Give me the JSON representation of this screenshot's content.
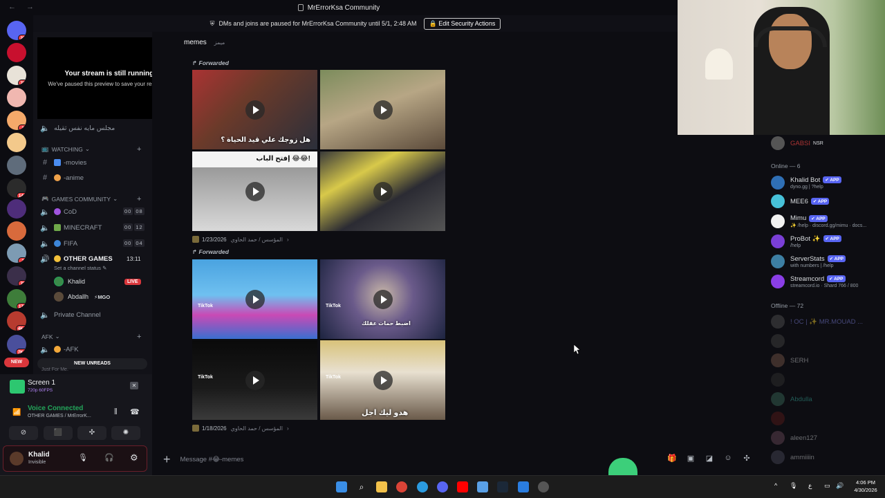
{
  "window": {
    "title": "MrErrorKsa Community"
  },
  "banner": {
    "message": "DMs and joins are paused for MrErrorKsa Community until 5/1, 2:48 AM",
    "button": "Edit Security Actions"
  },
  "servers": [
    {
      "icon": "discord-home-icon",
      "badge": "27",
      "color": "#5865f2"
    },
    {
      "icon": "nba-server-icon",
      "badge": "",
      "color": "#c8102e"
    },
    {
      "icon": "server-icon",
      "badge": "73",
      "color": "#e8e2d8"
    },
    {
      "icon": "server-icon",
      "badge": "",
      "color": "#f0b7b0"
    },
    {
      "icon": "server-icon",
      "badge": "1",
      "color": "#f4a96a"
    },
    {
      "icon": "server-icon",
      "badge": "",
      "color": "#f3c98b"
    },
    {
      "icon": "server-icon",
      "badge": "",
      "color": "#5f6c7b"
    },
    {
      "icon": "server-icon",
      "badge": "143",
      "color": "#2b2b2b"
    },
    {
      "icon": "server-icon",
      "badge": "",
      "color": "#4e2d7a"
    },
    {
      "icon": "server-icon",
      "badge": "",
      "color": "#d86a3c"
    },
    {
      "icon": "server-icon",
      "badge": "2",
      "color": "#7d9bb3"
    },
    {
      "icon": "server-icon",
      "badge": "73",
      "color": "#3b2f4a"
    },
    {
      "icon": "server-icon",
      "badge": "170",
      "color": "#3e7d3a"
    },
    {
      "icon": "server-icon",
      "badge": "4K+",
      "color": "#b73b2f"
    },
    {
      "icon": "server-icon",
      "badge": "7K+",
      "color": "#4a4f9c"
    },
    {
      "icon": "new-server-icon",
      "badge": "",
      "color": "#da373c"
    }
  ],
  "new_label": "NEW",
  "stream_preview": {
    "title": "Your stream is still running!",
    "subtitle": "We've paused this preview to save your resources."
  },
  "channels": {
    "top_voice": "مجلس مايه نفس ثقيله",
    "watching_category": "WATCHING",
    "watching": [
      "-movies",
      "-anime"
    ],
    "games_category": "GAMES COMMUNITY",
    "games": [
      {
        "name": "CoD",
        "counts": [
          "00",
          "08"
        ]
      },
      {
        "name": "MINECRAFT",
        "counts": [
          "00",
          "12"
        ]
      },
      {
        "name": "FIFA",
        "counts": [
          "00",
          "04"
        ]
      }
    ],
    "other_games": "OTHER GAMES",
    "other_games_time": "13:11",
    "status_hint": "Set a channel status",
    "voice_users": [
      {
        "name": "Khalid",
        "tag": "LIVE"
      },
      {
        "name": "Abdallh",
        "tag": "MGO"
      }
    ],
    "private": "Private Channel",
    "afk_category": "AFK",
    "afk": "-AFK",
    "new_unreads": "NEW UNREADS",
    "just_for_me": "Just For Me."
  },
  "screen_share": {
    "title": "Screen 1",
    "quality": "720p 60FPS"
  },
  "voice": {
    "status": "Voice Connected",
    "channel": "OTHER GAMES / MrErrorK..."
  },
  "user": {
    "name": "Khalid",
    "status": "Invisible"
  },
  "chat": {
    "channel": "memes",
    "channel_sub": "ميمز",
    "forwarded": "Forwarded",
    "groups": [
      {
        "captions": [
          "هل زوجك علي قيد الحياة ؟",
          "",
          "إفتح الباب 😂😂!",
          ""
        ],
        "date": "1/23/2026",
        "source": "المؤسس / حمد الحاوي"
      },
      {
        "captions": [
          "",
          "اضبط حمات عقلك",
          "",
          "هدو ليك اجل"
        ],
        "tiktok": "TikTok",
        "date": "1/18/2026",
        "source": "المؤسس / حمد الحاوي"
      }
    ],
    "composer_placeholder": "Message #😂-memes"
  },
  "members": {
    "top": {
      "name": "GABSI",
      "tag": "NSR"
    },
    "online_header": "Online — 6",
    "online": [
      {
        "name": "Khalid Bot",
        "status": "dyno.gg | ?help",
        "app": "APP",
        "color": "#2f6fb5"
      },
      {
        "name": "MEE6",
        "status": "",
        "app": "APP",
        "color": "#47c1d8"
      },
      {
        "name": "Mimu",
        "status": "✨ /help · discord.gg/mimu · docs...",
        "app": "APP",
        "color": "#f2f2f2"
      },
      {
        "name": "ProBot ✨",
        "status": "/help",
        "app": "APP",
        "color": "#7a3fd6"
      },
      {
        "name": "ServerStats",
        "status": "with numbers | /help",
        "app": "APP",
        "color": "#3d7fa3"
      },
      {
        "name": "Streamcord",
        "status": "streamcord.io · Shard 766 / 800",
        "app": "APP",
        "color": "#8a3ee6"
      }
    ],
    "offline_header": "Offline — 72",
    "offline": [
      "! OC | ✨ MR.MOUAD ...",
      "",
      "SERH",
      "",
      "Abdulla",
      "",
      "aleen127",
      "ammiiiin"
    ]
  },
  "taskbar": {
    "time": "4:06 PM",
    "date": "4/30/2026",
    "lang": "ع"
  }
}
